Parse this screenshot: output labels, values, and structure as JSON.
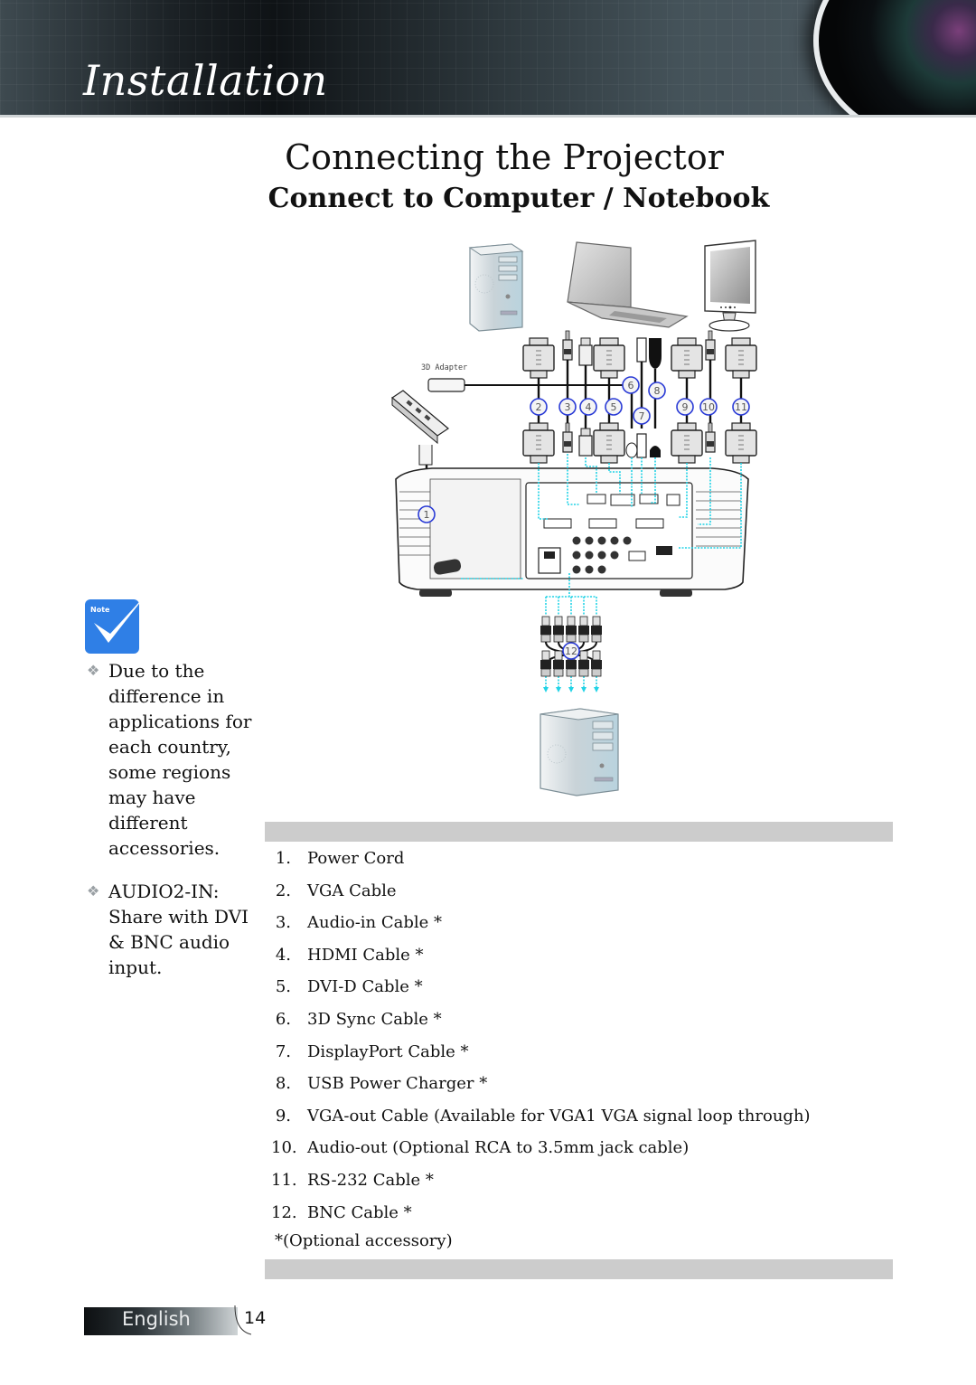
{
  "header": {
    "section_title": "Installation"
  },
  "page": {
    "title": "Connecting the Projector",
    "subtitle": "Connect to Computer / Notebook"
  },
  "diagram": {
    "adapter_label": "3D Adapter",
    "callouts": [
      "1",
      "2",
      "3",
      "4",
      "5",
      "6",
      "7",
      "8",
      "9",
      "10",
      "11",
      "12"
    ],
    "devices": [
      "desktop-computer",
      "notebook",
      "monitor",
      "power-strip",
      "projector",
      "desktop-computer"
    ],
    "callout_color": "#2a3bd6",
    "signal_line_color": "#22d3e6"
  },
  "note": {
    "icon_label": "Note",
    "icon_color": "#2f7fe6",
    "items": [
      "Due to the difference in applications for each country, some regions may have different accessories.",
      "AUDIO2-IN: Share with DVI & BNC audio input."
    ]
  },
  "cables": {
    "items": [
      {
        "num": "1.",
        "label": "Power Cord"
      },
      {
        "num": "2.",
        "label": "VGA Cable"
      },
      {
        "num": "3.",
        "label": "Audio-in Cable *"
      },
      {
        "num": "4.",
        "label": "HDMI Cable *"
      },
      {
        "num": "5.",
        "label": "DVI-D Cable *"
      },
      {
        "num": "6.",
        "label": "3D Sync Cable *"
      },
      {
        "num": "7.",
        "label": "DisplayPort Cable *"
      },
      {
        "num": "8.",
        "label": "USB Power Charger *"
      },
      {
        "num": "9.",
        "label": "VGA-out Cable (Available for VGA1 VGA signal loop through)"
      },
      {
        "num": "10.",
        "label": "Audio-out (Optional RCA to 3.5mm jack cable)"
      },
      {
        "num": "11.",
        "label": "RS-232 Cable *"
      },
      {
        "num": "12.",
        "label": "BNC Cable *"
      }
    ],
    "footnote": "*(Optional accessory)"
  },
  "footer": {
    "language": "English",
    "page_number": "14"
  }
}
